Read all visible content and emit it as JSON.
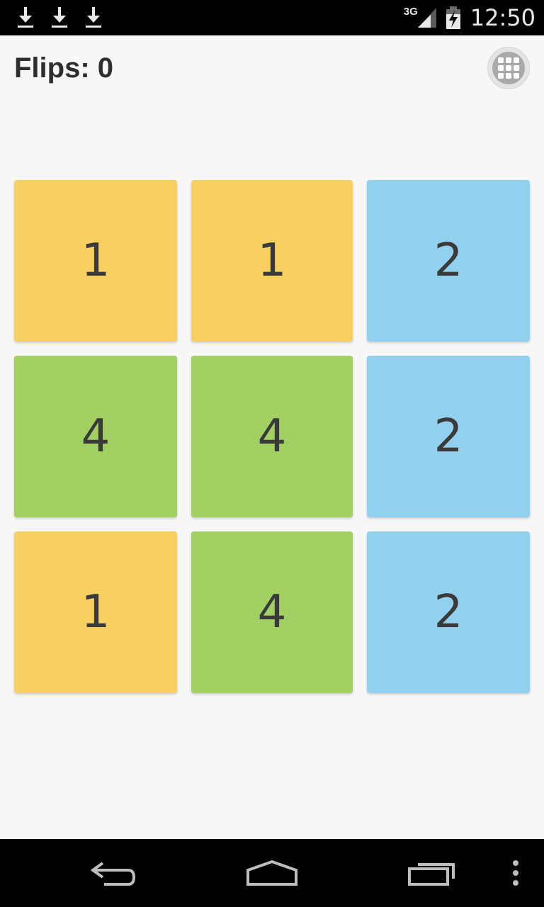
{
  "status_bar": {
    "download_icons": [
      "download-icon",
      "download-icon",
      "download-icon"
    ],
    "network_type": "3G",
    "time": "12:50"
  },
  "header": {
    "flips_label": "Flips: 0",
    "menu_icon": "grid-icon"
  },
  "board": {
    "tiles": [
      {
        "value": "1",
        "color": "#f8d062"
      },
      {
        "value": "1",
        "color": "#f8d062"
      },
      {
        "value": "2",
        "color": "#92d0f0"
      },
      {
        "value": "4",
        "color": "#a2d062"
      },
      {
        "value": "4",
        "color": "#a2d062"
      },
      {
        "value": "2",
        "color": "#92d0f0"
      },
      {
        "value": "1",
        "color": "#f8d062"
      },
      {
        "value": "4",
        "color": "#a2d062"
      },
      {
        "value": "2",
        "color": "#92d0f0"
      }
    ]
  },
  "nav_bar": {
    "icons": [
      "back-icon",
      "home-icon",
      "recents-icon",
      "overflow-menu-icon"
    ]
  }
}
